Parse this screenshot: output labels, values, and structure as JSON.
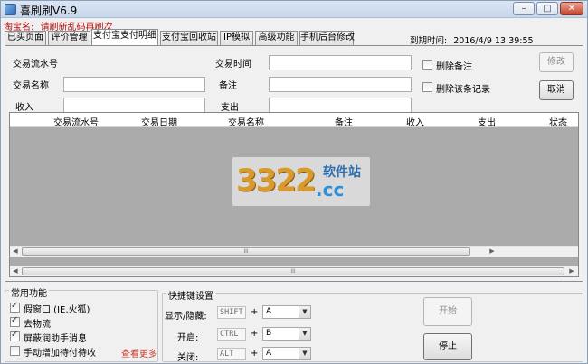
{
  "window": {
    "title": "喜刷刷V6.9",
    "minimize": "–",
    "maximize": "□",
    "close": "✕"
  },
  "store": {
    "label": "淘宝名:",
    "value": "请刷新乱码再刷次"
  },
  "tabs": [
    {
      "label": "已买页面"
    },
    {
      "label": "评价管理"
    },
    {
      "label": "支付宝支付明细",
      "active": true
    },
    {
      "label": "支付宝回收站"
    },
    {
      "label": "IP模拟"
    },
    {
      "label": "高级功能"
    },
    {
      "label": "手机后台修改"
    }
  ],
  "expire": {
    "label": "到期时间:",
    "value": "2016/4/9 13:39:55"
  },
  "form": {
    "serial_label": "交易流水号",
    "time_label": "交易时间",
    "name_label": "交易名称",
    "note_label": "备注",
    "income_label": "收入",
    "expense_label": "支出",
    "serial_value": "",
    "time_value": "",
    "name_value": "",
    "note_value": "",
    "income_value": "",
    "expense_value": "",
    "delete_note_label": "删除备注",
    "delete_record_label": "删除该条记录",
    "modify_button": "修改",
    "cancel_button": "取消"
  },
  "grid": {
    "columns": [
      "交易流水号",
      "交易日期",
      "交易名称",
      "备注",
      "收入",
      "支出",
      "状态"
    ],
    "rows": [],
    "scroll_grip": "III"
  },
  "watermark": {
    "number": "3322",
    "cn": "软件站",
    "domain": ".cc"
  },
  "common": {
    "title": "常用功能",
    "options": [
      {
        "label": "假窗口 (IE,火狐)",
        "checked": true
      },
      {
        "label": "去物流",
        "checked": true
      },
      {
        "label": "屏蔽润助手消息",
        "checked": true
      },
      {
        "label": "手动增加待付待收",
        "checked": false
      }
    ],
    "more_link": "查看更多"
  },
  "hotkeys": {
    "title": "快捷键设置",
    "rows": [
      {
        "label": "显示/隐藏:",
        "mod": "SHIFT",
        "key": "A"
      },
      {
        "label": "开启:",
        "mod": "CTRL",
        "key": "B"
      },
      {
        "label": "关闭:",
        "mod": "ALT",
        "key": "A"
      }
    ],
    "plus": "+"
  },
  "actions": {
    "start": "开始",
    "stop": "停止"
  },
  "colors": {
    "accent_red": "#b01010",
    "link_red": "#c0392b",
    "grid_bg": "#ababab"
  }
}
